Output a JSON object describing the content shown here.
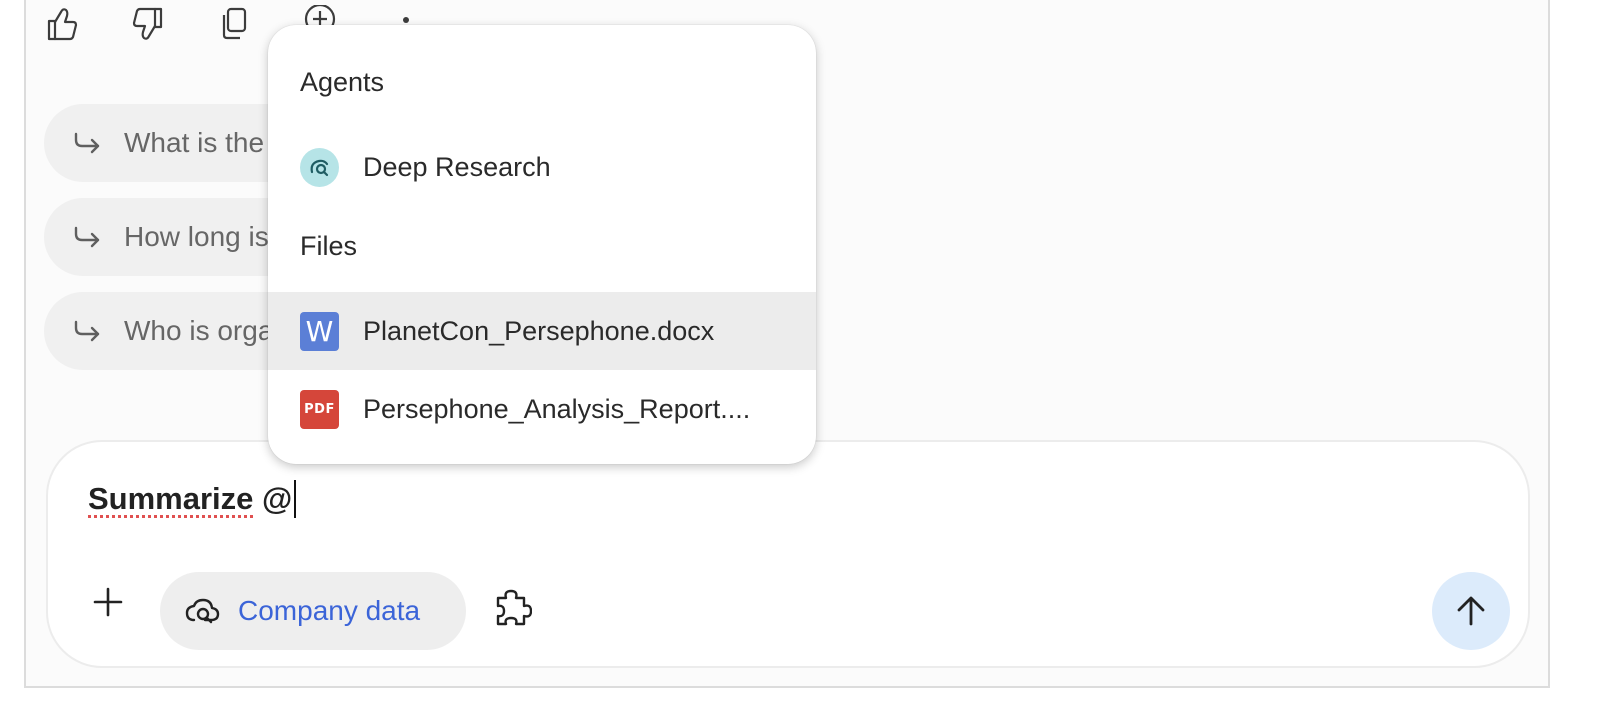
{
  "response_actions": {
    "icons": [
      "thumbs-up-icon",
      "thumbs-down-icon",
      "copy-icon",
      "add-circle-icon",
      "more-vertical-icon"
    ]
  },
  "suggestions": [
    {
      "text": "What is the"
    },
    {
      "text": "How long is"
    },
    {
      "text": "Who is orga"
    }
  ],
  "mention_menu": {
    "agents_heading": "Agents",
    "agents": [
      {
        "label": "Deep Research",
        "icon": "deep-research-icon"
      }
    ],
    "files_heading": "Files",
    "files": [
      {
        "label": "PlanetCon_Persephone.docx",
        "icon": "word-file-icon",
        "icon_text": "W",
        "color": "#5b7fd6",
        "highlighted": true
      },
      {
        "label": "Persephone_Analysis_Report....",
        "icon": "pdf-file-icon",
        "icon_text": "PDF",
        "color": "#d5463a",
        "highlighted": false
      }
    ]
  },
  "composer": {
    "prompt_word": "Summarize",
    "prompt_mention": " @",
    "company_chip_label": "Company data",
    "send_button_color": "#dcebfb",
    "accent_color": "#3b64d8"
  }
}
